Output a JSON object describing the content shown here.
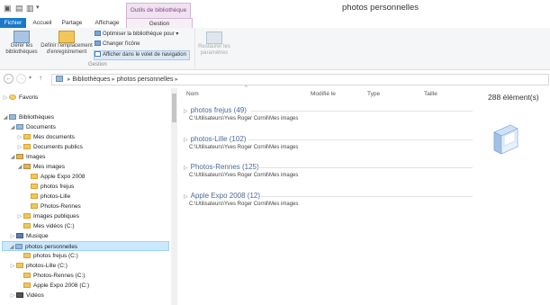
{
  "window": {
    "title": "photos personnelles",
    "context_tab_group": "Outils de bibliothèque"
  },
  "tabs": [
    "Fichier",
    "Accueil",
    "Partage",
    "Affichage",
    "Gestion"
  ],
  "ribbon": {
    "manage_libraries_label": "Gérer les bibliothèques",
    "set_save_location_label": "Définir l'emplacement d'enregistrement",
    "optimize_label": "Optimiser la bibliothèque pour",
    "change_icon_label": "Changer l'icône",
    "show_in_nav_label": "Afficher dans le volet de navigation",
    "restore_label": "Restaurer les paramètres",
    "group_label": "Gestion"
  },
  "address": {
    "segments": [
      "Bibliothèques",
      "photos personnelles"
    ]
  },
  "nav": {
    "favoris": "Favoris",
    "bibliotheques": "Bibliothèques",
    "documents": "Documents",
    "mes_documents": "Mes documents",
    "documents_publics": "Documents publics",
    "images": "Images",
    "mes_images": "Mes images",
    "apple_expo": "Apple Expo 2008",
    "photos_frejus": "photos frejus",
    "photos_lille": "photos-Lille",
    "photos_rennes": "Photos-Rennes",
    "images_publiques": "Images publiques",
    "mes_videos": "Mes vidéos (C:)",
    "musique": "Musique",
    "photos_personnelles": "photos personnelles",
    "frejus_c": "photos frejus (C:)",
    "lille_c": "photos-Lille (C:)",
    "rennes_c": "Photos-Rennes (C:)",
    "apple_c": "Apple Expo 2008 (C:)",
    "videos": "Vidéos"
  },
  "columns": [
    "Nom",
    "Modifié le",
    "Type",
    "Taille"
  ],
  "item_count": "288 élément(s)",
  "groups": [
    {
      "title": "photos frejus (49)",
      "path": "C:\\Utilisateurs\\Yves Roger Cornil\\Mes images"
    },
    {
      "title": "photos-Lille (102)",
      "path": "C:\\Utilisateurs\\Yves Roger Cornil\\Mes images"
    },
    {
      "title": "Photos-Rennes (125)",
      "path": "C:\\Utilisateurs\\Yves Roger Cornil\\Mes images"
    },
    {
      "title": "Apple Expo 2008 (12)",
      "path": "C:\\Utilisateurs\\Yves Roger Cornil\\Mes images"
    }
  ],
  "colors": {
    "accent": "#1979ca",
    "context": "#8a3f8a",
    "selection": "#cce8ff",
    "group_title": "#4a6a97"
  }
}
